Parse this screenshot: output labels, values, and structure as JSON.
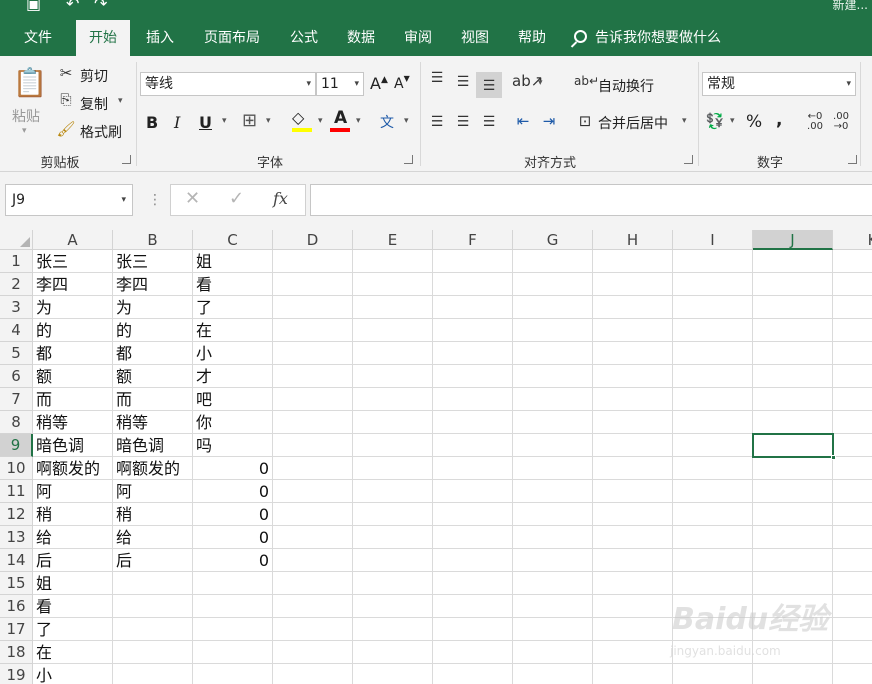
{
  "window": {
    "title": "新建..."
  },
  "tabs": [
    {
      "label": "文件",
      "active": false
    },
    {
      "label": "开始",
      "active": true
    },
    {
      "label": "插入",
      "active": false
    },
    {
      "label": "页面布局",
      "active": false
    },
    {
      "label": "公式",
      "active": false
    },
    {
      "label": "数据",
      "active": false
    },
    {
      "label": "审阅",
      "active": false
    },
    {
      "label": "视图",
      "active": false
    },
    {
      "label": "帮助",
      "active": false
    }
  ],
  "tell_me": "告诉我你想要做什么",
  "clipboard": {
    "paste": "粘贴",
    "cut": "剪切",
    "copy": "复制",
    "format_painter": "格式刷",
    "group_label": "剪贴板"
  },
  "font": {
    "name": "等线",
    "size": "11",
    "group_label": "字体",
    "grow": "A",
    "shrink": "A",
    "bold": "B",
    "italic": "I",
    "underline": "U",
    "font_color_glyph": "A",
    "phonetic_glyph": "文",
    "font_color": "#ff0000",
    "fill_color": "#ffff00"
  },
  "alignment": {
    "wrap_text": "自动换行",
    "merge_center": "合并后居中",
    "group_label": "对齐方式"
  },
  "number": {
    "format": "常规",
    "percent": "%",
    "comma": ",",
    "group_label": "数字"
  },
  "formula_bar": {
    "name_box": "J9",
    "cancel": "✕",
    "enter": "✓",
    "fx": "fx",
    "content": ""
  },
  "columns": [
    "A",
    "B",
    "C",
    "D",
    "E",
    "F",
    "G",
    "H",
    "I",
    "J",
    "K"
  ],
  "selected_cell": {
    "column": "J",
    "row": "9"
  },
  "rows": [
    {
      "num": "1",
      "A": "张三",
      "B": "张三",
      "C": "姐"
    },
    {
      "num": "2",
      "A": "李四",
      "B": "李四",
      "C": "看"
    },
    {
      "num": "3",
      "A": "为",
      "B": "为",
      "C": "了"
    },
    {
      "num": "4",
      "A": "的",
      "B": "的",
      "C": "在"
    },
    {
      "num": "5",
      "A": "都",
      "B": "都",
      "C": "小"
    },
    {
      "num": "6",
      "A": "额",
      "B": "额",
      "C": "才"
    },
    {
      "num": "7",
      "A": "而",
      "B": "而",
      "C": "吧"
    },
    {
      "num": "8",
      "A": "稍等",
      "B": "稍等",
      "C": "你"
    },
    {
      "num": "9",
      "A": "暗色调",
      "B": "暗色调",
      "C": "吗"
    },
    {
      "num": "10",
      "A": "啊额发的",
      "B": "啊额发的",
      "C": "0"
    },
    {
      "num": "11",
      "A": "阿",
      "B": "阿",
      "C": "0"
    },
    {
      "num": "12",
      "A": "稍",
      "B": "稍",
      "C": "0"
    },
    {
      "num": "13",
      "A": "给",
      "B": "给",
      "C": "0"
    },
    {
      "num": "14",
      "A": "后",
      "B": "后",
      "C": "0"
    },
    {
      "num": "15",
      "A": "姐",
      "B": "",
      "C": ""
    },
    {
      "num": "16",
      "A": "看",
      "B": "",
      "C": ""
    },
    {
      "num": "17",
      "A": "了",
      "B": "",
      "C": ""
    },
    {
      "num": "18",
      "A": "在",
      "B": "",
      "C": ""
    },
    {
      "num": "19",
      "A": "小",
      "B": "",
      "C": ""
    }
  ],
  "watermark": {
    "logo": "Baidu经验",
    "url": "jingyan.baidu.com"
  },
  "colors": {
    "accent": "#217346",
    "ribbon_bg": "#f3f3f3"
  }
}
